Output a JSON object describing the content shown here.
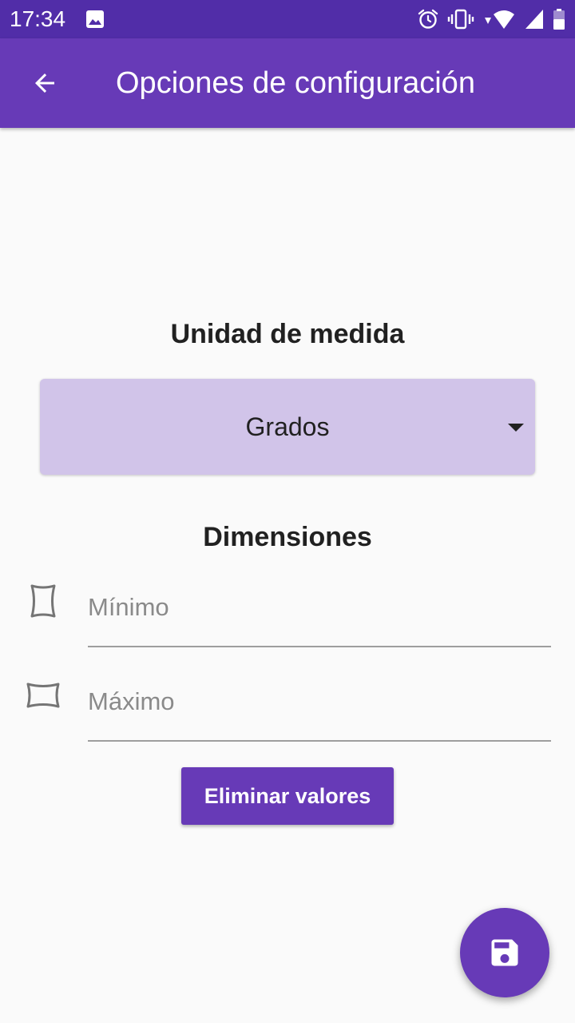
{
  "status_bar": {
    "time": "17:34",
    "icons": [
      "image-icon",
      "alarm-icon",
      "vibrate-icon",
      "wifi-icon",
      "signal-icon",
      "battery-icon"
    ]
  },
  "app_bar": {
    "title": "Opciones de configuración",
    "back_icon": "arrow-back-icon"
  },
  "unit_section": {
    "title": "Unidad de medida",
    "spinner_value": "Grados"
  },
  "dimensions_section": {
    "title": "Dimensiones",
    "min_field": {
      "placeholder": "Mínimo",
      "value": "",
      "icon": "narrow-shape-icon"
    },
    "max_field": {
      "placeholder": "Máximo",
      "value": "",
      "icon": "wide-shape-icon"
    }
  },
  "clear_button": {
    "label": "Eliminar valores"
  },
  "fab": {
    "icon": "save-icon"
  },
  "colors": {
    "status_bar": "#512da8",
    "primary": "#673ab7",
    "spinner_bg": "#d1c4e9",
    "background": "#fafafa"
  }
}
